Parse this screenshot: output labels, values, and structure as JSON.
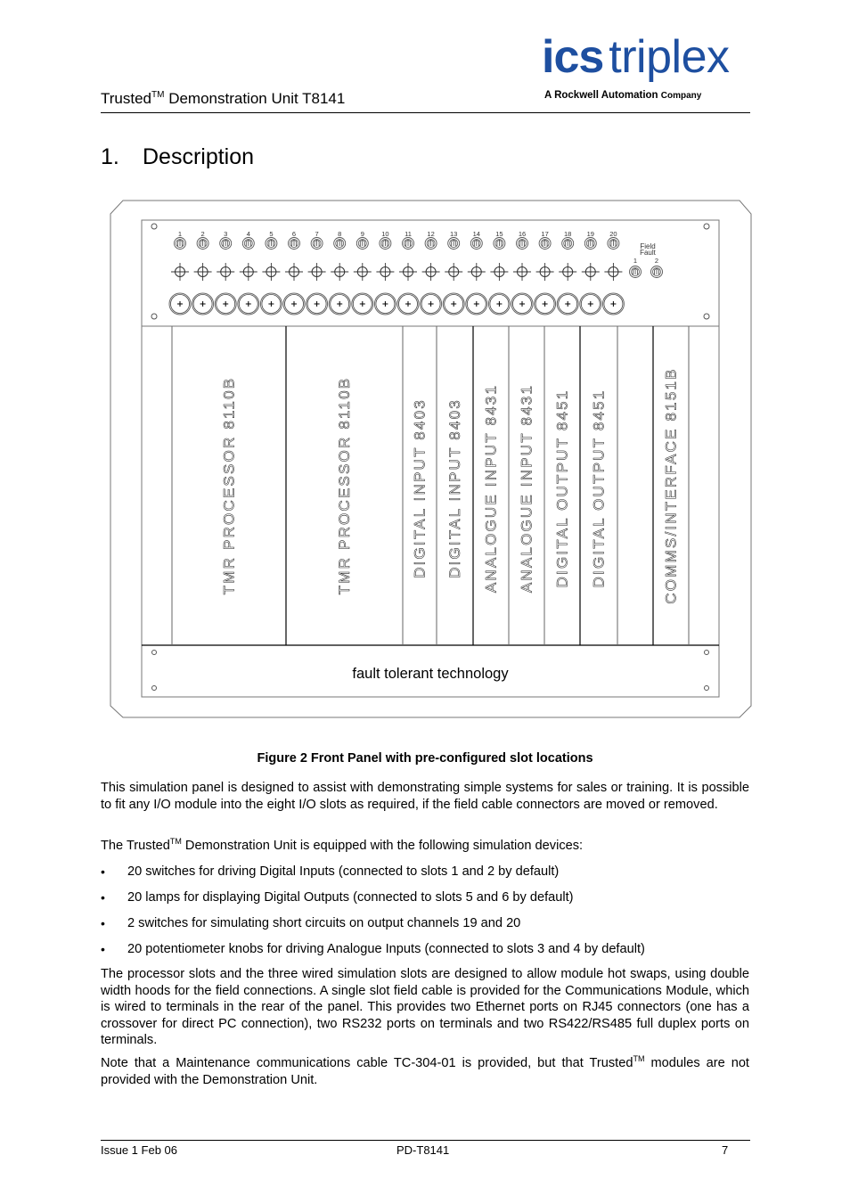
{
  "header": {
    "title_prefix": "Trusted",
    "title_tm": "TM",
    "title_suffix": " Demonstration Unit T8141",
    "logo_ics": "ics",
    "logo_triplex": "triplex",
    "logo_sub_a": "A Rockwell Automation",
    "logo_sub_company": "Company",
    "brand_color": "#1e4fa0"
  },
  "section": {
    "number": "1.",
    "title": "Description"
  },
  "figure": {
    "caption": "Figure 2 Front Panel with pre-configured slot locations",
    "switch_labels": [
      "1",
      "2",
      "3",
      "4",
      "5",
      "6",
      "7",
      "8",
      "9",
      "10",
      "11",
      "12",
      "13",
      "14",
      "15",
      "16",
      "17",
      "18",
      "19",
      "20"
    ],
    "field_fault_label_1": "Field",
    "field_fault_label_2": "Fault",
    "field_fault_switches": [
      "1",
      "2"
    ],
    "slots": [
      {
        "label": ""
      },
      {
        "label": "TMR  PROCESSOR  8110B"
      },
      {
        "label": "TMR  PROCESSOR  8110B"
      },
      {
        "label": "DIGITAL  INPUT  8403"
      },
      {
        "label": "DIGITAL  INPUT  8403"
      },
      {
        "label": "ANALOGUE  INPUT  8431"
      },
      {
        "label": "ANALOGUE  INPUT  8431"
      },
      {
        "label": "DIGITAL  OUTPUT  8451"
      },
      {
        "label": "DIGITAL  OUTPUT  8451"
      },
      {
        "label": ""
      },
      {
        "label": "COMMS/INTERFACE  8151B"
      },
      {
        "label": ""
      }
    ],
    "footer_text": "fault tolerant technology"
  },
  "body": {
    "p1": "This simulation panel is designed to assist with demonstrating simple systems for sales or training. It is possible to fit any I/O module into the eight I/O slots as required, if the field cable connectors are moved or removed.",
    "p2_prefix": "The Trusted",
    "p2_tm": "TM",
    "p2_suffix": " Demonstration Unit is equipped with the following simulation devices:",
    "bullets": [
      "20 switches for driving Digital Inputs (connected to slots 1 and 2 by default)",
      "20 lamps for displaying Digital Outputs (connected to slots 5 and 6 by default)",
      "2 switches for simulating short circuits on output channels 19 and 20",
      "20 potentiometer knobs for driving Analogue Inputs (connected to slots 3 and 4 by default)"
    ],
    "bullet_glyph": "•",
    "p3": "The processor slots and the three wired simulation slots are designed to allow module hot swaps, using double width hoods for the field connections. A single slot field cable is provided for the Communications Module, which is wired to terminals in the rear of the panel. This provides two Ethernet ports on RJ45 connectors (one has a crossover for direct PC connection), two RS232 ports on terminals and two RS422/RS485 full duplex ports on terminals.",
    "p4_prefix": "Note that a Maintenance communications cable TC-304-01 is provided, but that Trusted",
    "p4_tm": "TM",
    "p4_suffix": " modules are not provided with the Demonstration Unit."
  },
  "footer": {
    "issue": "Issue 1 Feb 06",
    "doc_id": "PD-T8141",
    "page": "7"
  }
}
